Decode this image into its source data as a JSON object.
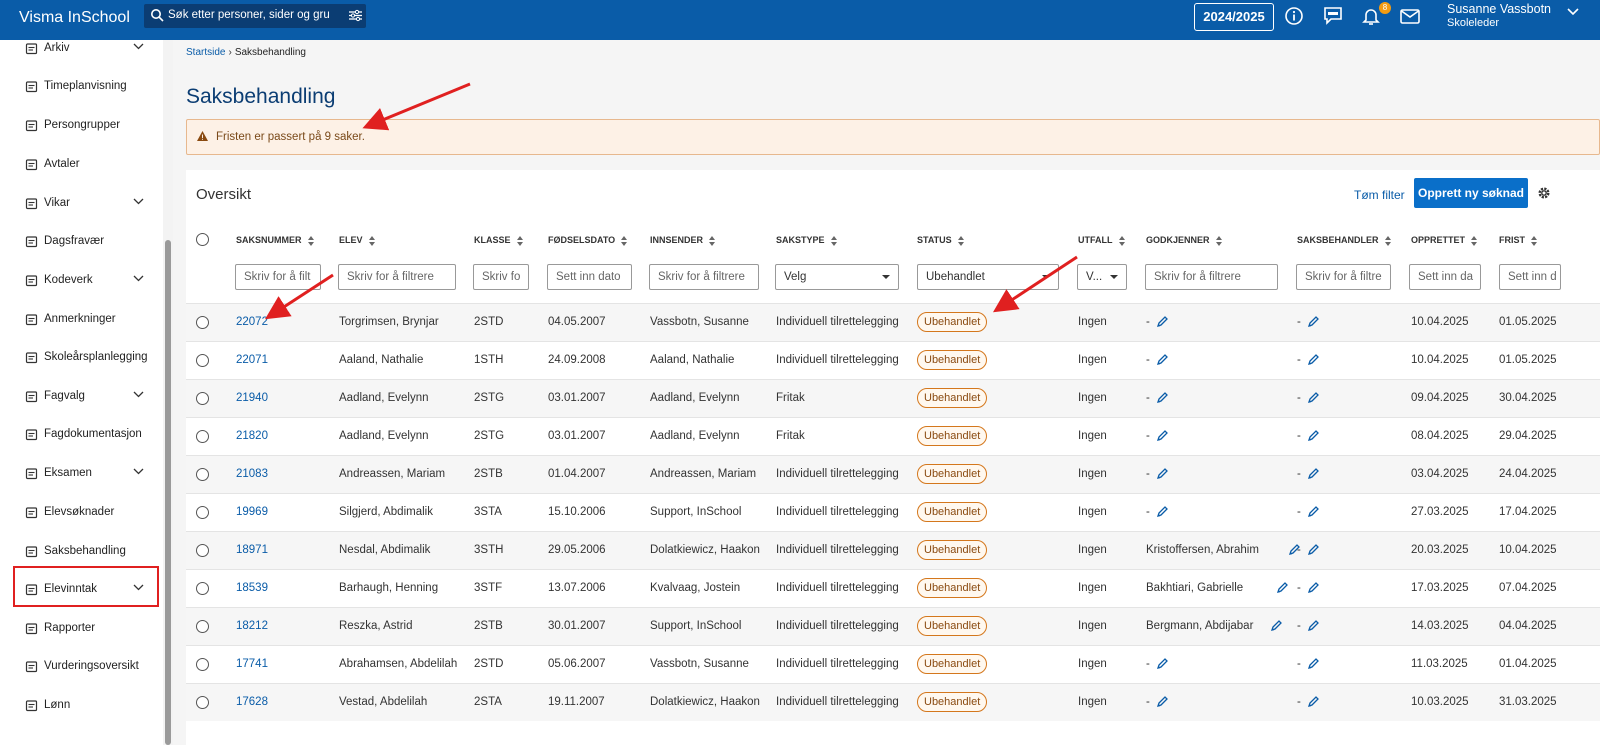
{
  "app": {
    "brand": "Visma InSchool"
  },
  "topbar": {
    "search_placeholder": "Søk etter personer, sider og gru",
    "year_label": "2024/2025",
    "notification_count": "8",
    "user_name": "Susanne Vassbotn",
    "user_role": "Skoleleder"
  },
  "sidebar": {
    "items": [
      {
        "label": "Arkiv",
        "icon": "archive-icon",
        "chevron": true
      },
      {
        "label": "Timeplanvisning",
        "icon": "calendar-icon",
        "chevron": false
      },
      {
        "label": "Persongrupper",
        "icon": "people-icon",
        "chevron": false
      },
      {
        "label": "Avtaler",
        "icon": "calendar-check-icon",
        "chevron": false
      },
      {
        "label": "Vikar",
        "icon": "swap-icon",
        "chevron": true
      },
      {
        "label": "Dagsfravær",
        "icon": "person-absence-icon",
        "chevron": false
      },
      {
        "label": "Kodeverk",
        "icon": "database-icon",
        "chevron": true
      },
      {
        "label": "Anmerkninger",
        "icon": "hand-icon",
        "chevron": false
      },
      {
        "label": "Skoleårsplanlegging",
        "icon": "calendar-plan-icon",
        "chevron": false
      },
      {
        "label": "Fagvalg",
        "icon": "list-icon",
        "chevron": true
      },
      {
        "label": "Fagdokumentasjon",
        "icon": "document-icon",
        "chevron": false
      },
      {
        "label": "Eksamen",
        "icon": "exam-icon",
        "chevron": true
      },
      {
        "label": "Elevsøknader",
        "icon": "inbox-icon",
        "chevron": false
      },
      {
        "label": "Saksbehandling",
        "icon": "folder-icon",
        "chevron": false
      },
      {
        "label": "Elevinntak",
        "icon": "person-add-icon",
        "chevron": true
      },
      {
        "label": "Rapporter",
        "icon": "chart-icon",
        "chevron": false
      },
      {
        "label": "Vurderingsoversikt",
        "icon": "assessment-icon",
        "chevron": false
      },
      {
        "label": "Lønn",
        "icon": "salary-icon",
        "chevron": false
      }
    ],
    "active": "Saksbehandling"
  },
  "breadcrumb": {
    "home": "Startside",
    "current": "Saksbehandling"
  },
  "page": {
    "title": "Saksbehandling",
    "alert": "Fristen er passert på 9 saker.",
    "card_title": "Oversikt",
    "clear_filter": "Tøm filter",
    "new_button": "Opprett ny søknad"
  },
  "table": {
    "headers": [
      "Saksnummer",
      "Elev",
      "Klasse",
      "Fødselsdato",
      "Innsender",
      "Sakstype",
      "Status",
      "Utfall",
      "Godkjenner",
      "Saksbehandler",
      "Opprettet",
      "Frist"
    ],
    "filters": {
      "saksnummer": "Skriv for å filt",
      "elev": "Skriv for å filtrere",
      "klasse": "Skriv fo",
      "fodselsdato": "Sett inn dato",
      "innsender": "Skriv for å filtrere",
      "sakstype": "Velg",
      "status": "Ubehandlet",
      "utfall": "V...",
      "godkjenner": "Skriv for å filtrere",
      "saksbehandler": "Skriv for å filtre",
      "opprettet": "Sett inn da",
      "frist": "Sett inn d"
    },
    "rows": [
      {
        "id": "22072",
        "elev": "Torgrimsen, Brynjar",
        "klasse": "2STD",
        "fodt": "04.05.2007",
        "innsender": "Vassbotn, Susanne",
        "type": "Individuell tilrettelegging",
        "status": "Ubehandlet",
        "utfall": "Ingen",
        "godkjenner": "-",
        "saksbehandler": "-",
        "opprettet": "10.04.2025",
        "frist": "01.05.2025"
      },
      {
        "id": "22071",
        "elev": "Aaland, Nathalie",
        "klasse": "1STH",
        "fodt": "24.09.2008",
        "innsender": "Aaland, Nathalie",
        "type": "Individuell tilrettelegging",
        "status": "Ubehandlet",
        "utfall": "Ingen",
        "godkjenner": "-",
        "saksbehandler": "-",
        "opprettet": "10.04.2025",
        "frist": "01.05.2025"
      },
      {
        "id": "21940",
        "elev": "Aadland, Evelynn",
        "klasse": "2STG",
        "fodt": "03.01.2007",
        "innsender": "Aadland, Evelynn",
        "type": "Fritak",
        "status": "Ubehandlet",
        "utfall": "Ingen",
        "godkjenner": "-",
        "saksbehandler": "-",
        "opprettet": "09.04.2025",
        "frist": "30.04.2025"
      },
      {
        "id": "21820",
        "elev": "Aadland, Evelynn",
        "klasse": "2STG",
        "fodt": "03.01.2007",
        "innsender": "Aadland, Evelynn",
        "type": "Fritak",
        "status": "Ubehandlet",
        "utfall": "Ingen",
        "godkjenner": "-",
        "saksbehandler": "-",
        "opprettet": "08.04.2025",
        "frist": "29.04.2025"
      },
      {
        "id": "21083",
        "elev": "Andreassen, Mariam",
        "klasse": "2STB",
        "fodt": "01.04.2007",
        "innsender": "Andreassen, Mariam",
        "type": "Individuell tilrettelegging",
        "status": "Ubehandlet",
        "utfall": "Ingen",
        "godkjenner": "-",
        "saksbehandler": "-",
        "opprettet": "03.04.2025",
        "frist": "24.04.2025"
      },
      {
        "id": "19969",
        "elev": "Silgjerd, Abdimalik",
        "klasse": "3STA",
        "fodt": "15.10.2006",
        "innsender": "Support, InSchool",
        "type": "Individuell tilrettelegging",
        "status": "Ubehandlet",
        "utfall": "Ingen",
        "godkjenner": "-",
        "saksbehandler": "-",
        "opprettet": "27.03.2025",
        "frist": "17.04.2025"
      },
      {
        "id": "18971",
        "elev": "Nesdal, Abdimalik",
        "klasse": "3STH",
        "fodt": "29.05.2006",
        "innsender": "Dolatkiewicz, Haakon",
        "type": "Individuell tilrettelegging",
        "status": "Ubehandlet",
        "utfall": "Ingen",
        "godkjenner": "Kristoffersen, Abrahim",
        "saksbehandler": "-",
        "opprettet": "20.03.2025",
        "frist": "10.04.2025"
      },
      {
        "id": "18539",
        "elev": "Barhaugh, Henning",
        "klasse": "3STF",
        "fodt": "13.07.2006",
        "innsender": "Kvalvaag, Jostein",
        "type": "Individuell tilrettelegging",
        "status": "Ubehandlet",
        "utfall": "Ingen",
        "godkjenner": "Bakhtiari, Gabrielle",
        "saksbehandler": "-",
        "opprettet": "17.03.2025",
        "frist": "07.04.2025"
      },
      {
        "id": "18212",
        "elev": "Reszka, Astrid",
        "klasse": "2STB",
        "fodt": "30.01.2007",
        "innsender": "Support, InSchool",
        "type": "Individuell tilrettelegging",
        "status": "Ubehandlet",
        "utfall": "Ingen",
        "godkjenner": "Bergmann, Abdijabar",
        "saksbehandler": "-",
        "opprettet": "14.03.2025",
        "frist": "04.04.2025"
      },
      {
        "id": "17741",
        "elev": "Abrahamsen, Abdelilah",
        "klasse": "2STD",
        "fodt": "05.06.2007",
        "innsender": "Vassbotn, Susanne",
        "type": "Individuell tilrettelegging",
        "status": "Ubehandlet",
        "utfall": "Ingen",
        "godkjenner": "-",
        "saksbehandler": "-",
        "opprettet": "11.03.2025",
        "frist": "01.04.2025"
      },
      {
        "id": "17628",
        "elev": "Vestad, Abdelilah",
        "klasse": "2STA",
        "fodt": "19.11.2007",
        "innsender": "Dolatkiewicz, Haakon",
        "type": "Individuell tilrettelegging",
        "status": "Ubehandlet",
        "utfall": "Ingen",
        "godkjenner": "-",
        "saksbehandler": "-",
        "opprettet": "10.03.2025",
        "frist": "31.03.2025"
      }
    ]
  },
  "colors": {
    "topbar": "#0a5ca8",
    "accent": "#0a6fc9",
    "annotation": "#e02020",
    "status_border": "#d4771c"
  }
}
